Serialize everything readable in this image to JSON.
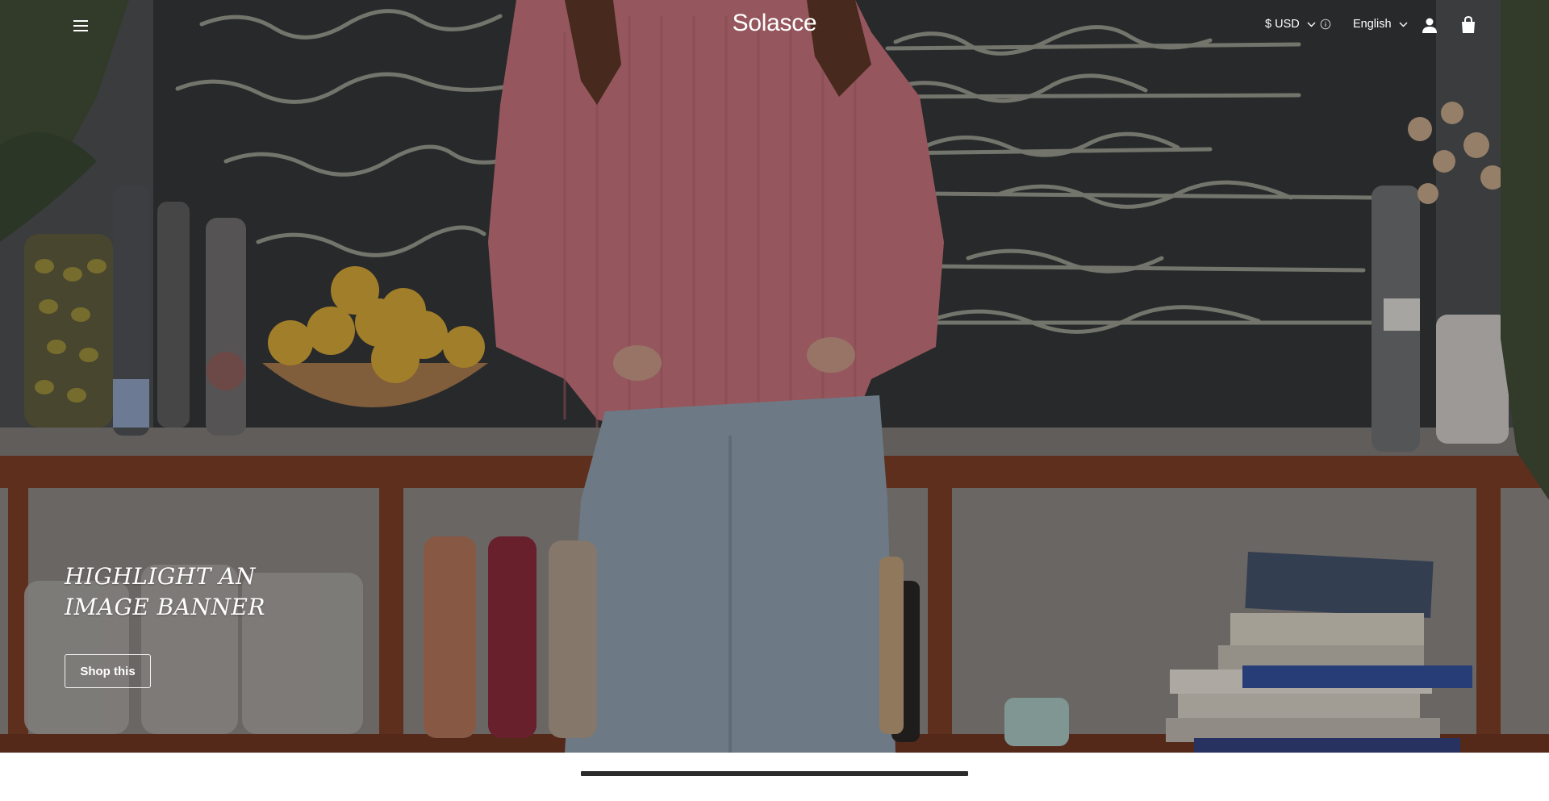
{
  "header": {
    "brand": "Solasce",
    "currency": "$ USD",
    "language": "English",
    "icons": {
      "menu": "hamburger-menu-icon",
      "currency_chevron": "chevron-down-icon",
      "info": "info-icon",
      "language_chevron": "chevron-down-icon",
      "account": "account-icon",
      "cart": "shopping-bag-icon"
    }
  },
  "banner": {
    "title_line1": "HIGHLIGHT AN",
    "title_line2": "IMAGE BANNER",
    "button_label": "Shop this"
  },
  "slideshow": {
    "indicator": "slide-progress-bar"
  },
  "colors": {
    "text": "#ffffff",
    "indicator": "#2b2b2b",
    "page_background": "#ffffff"
  }
}
